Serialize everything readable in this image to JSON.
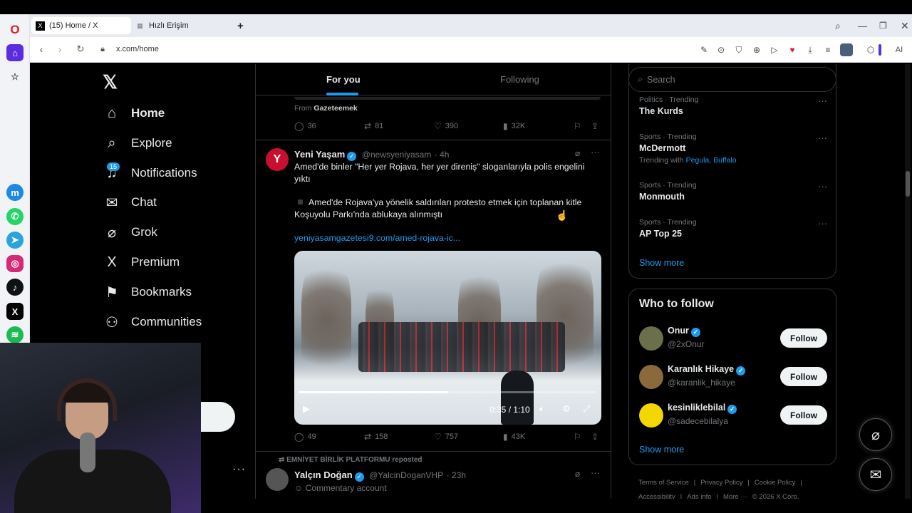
{
  "browser": {
    "tabs": [
      {
        "label": "(15) Home / X",
        "favicon": "x-logo-icon"
      },
      {
        "label": "Hızlı Erişim",
        "favicon": "grid-icon"
      }
    ],
    "url": "x.com/home",
    "ai_label": "AI"
  },
  "nav": {
    "logo": "𝕏",
    "items": [
      {
        "label": "Home",
        "icon": "home-icon"
      },
      {
        "label": "Explore",
        "icon": "search-icon"
      },
      {
        "label": "Notifications",
        "icon": "bell-icon"
      },
      {
        "label": "Chat",
        "icon": "mail-icon"
      },
      {
        "label": "Grok",
        "icon": "grok-icon"
      },
      {
        "label": "Premium",
        "icon": "x-icon"
      },
      {
        "label": "Bookmarks",
        "icon": "bookmark-icon"
      },
      {
        "label": "Communities",
        "icon": "people-icon"
      }
    ],
    "notif_count": "15"
  },
  "feed": {
    "tabs": [
      "For you",
      "Following"
    ],
    "prev_post": {
      "from_prefix": "From",
      "from": "Gazeteemek",
      "replies": "36",
      "reposts": "81",
      "likes": "390",
      "views": "32K"
    },
    "post": {
      "name": "Yeni Yaşam",
      "handle": "@newsyeniyasam",
      "time": "· 4h",
      "text1": "Amed'de binler \"Her yer Rojava, her yer direniş\" sloganlarıyla polis engelini yıktı",
      "text2": "Amed'de Rojava'ya yönelik saldırıları protesto etmek için toplanan kitle Koşuyolu Parkı'nda ablukaya alınmıştı",
      "link": "yeniyasamgazetesi9.com/amed-rojava-ic...",
      "video_time": "0:35 / 1:10",
      "progress": 0.5,
      "replies": "49",
      "reposts": "158",
      "likes": "757",
      "views": "43K"
    },
    "next_post": {
      "reposted_by": "EMNİYET BİRLİK PLATFORMU reposted",
      "name": "Yalçın Doğan",
      "handle": "@YalcinDoganVHP",
      "time": "· 23h",
      "label": "Commentary account"
    }
  },
  "right": {
    "search_placeholder": "Search",
    "trends": [
      {
        "category": "Politics · Trending",
        "title": "The Kurds"
      },
      {
        "category": "Sports · Trending",
        "title": "McDermott",
        "with_prefix": "Trending with",
        "with": "Pegula, Buffalo"
      },
      {
        "category": "Sports · Trending",
        "title": "Monmouth"
      },
      {
        "category": "Sports · Trending",
        "title": "AP Top 25"
      }
    ],
    "show_more": "Show more",
    "who_to_follow": "Who to follow",
    "follow_label": "Follow",
    "suggestions": [
      {
        "name": "Onur",
        "handle": "@2xOnur"
      },
      {
        "name": "Karanlık Hikaye",
        "handle": "@karanlik_hikaye"
      },
      {
        "name": "kesinliklebilal",
        "handle": "@sadecebilalya"
      }
    ],
    "footer": [
      "Terms of Service",
      "|",
      "Privacy Policy",
      "|",
      "Cookie Policy",
      "|",
      "Accessibility",
      "|",
      "Ads info",
      "|",
      "More ···",
      "© 2026 X Corp."
    ]
  },
  "colors": {
    "accent": "#1d9bf0",
    "background": "#000000",
    "border": "#2f3336",
    "muted": "#71767b"
  }
}
